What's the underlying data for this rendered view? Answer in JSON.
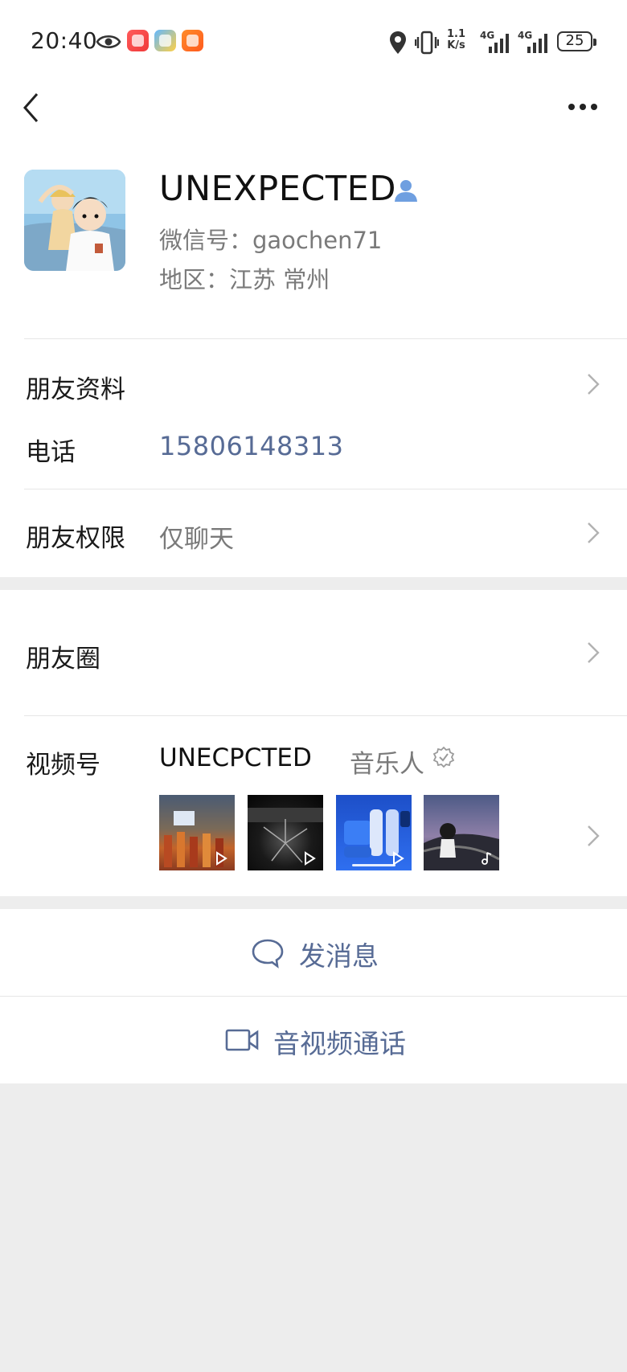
{
  "status_bar": {
    "time": "20:40",
    "network_speed_value": "1.1",
    "network_speed_unit": "K/s",
    "signal1_label": "4G",
    "signal2_label": "4G",
    "battery_level": "25",
    "icons": [
      "eye-icon",
      "location-icon",
      "vibrate-icon",
      "signal-icon",
      "battery-icon"
    ]
  },
  "nav": {
    "back_icon": "chevron-left-icon",
    "more_icon": "more-dots-icon"
  },
  "profile": {
    "nickname": "UNEXPECTED",
    "wechat_id": "微信号：gaochen71",
    "region": "地区：江苏  常州"
  },
  "rows": {
    "friend_info_label": "朋友资料",
    "phone_label": "电话",
    "phone_value": "15806148313",
    "permissions_label": "朋友权限",
    "permissions_value": "仅聊天",
    "moments_label": "朋友圈",
    "channels_label": "视频号",
    "channel_name": "UNECPCTED",
    "channel_role": "音乐人"
  },
  "actions": {
    "send_message": "发消息",
    "av_call": "音视频通话"
  },
  "colors": {
    "link_blue": "#576b95",
    "background_gray": "#ededed",
    "contact_badge": "#6f9fe0"
  }
}
